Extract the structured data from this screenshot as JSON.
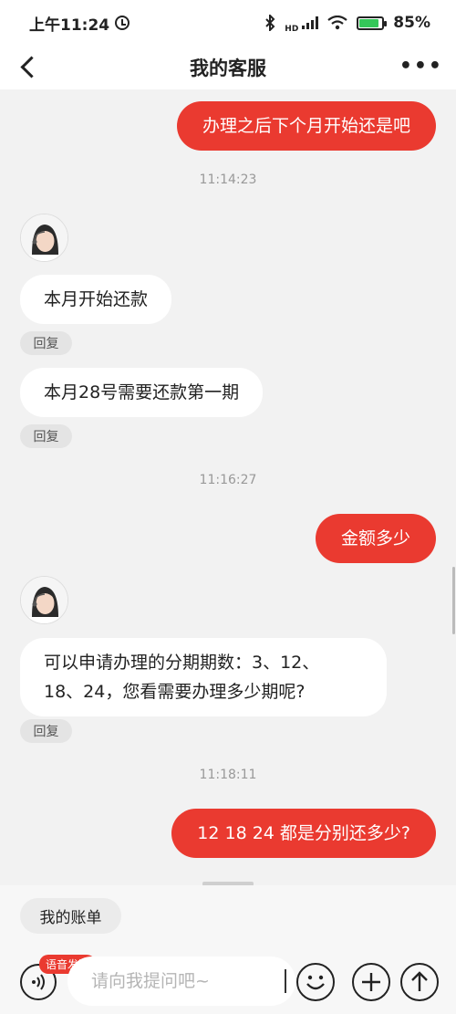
{
  "status_bar": {
    "time": "上午11:24",
    "network_badge": "HD",
    "battery": "85%"
  },
  "header": {
    "title": "我的客服"
  },
  "chat": {
    "messages": [
      {
        "text": "办理之后下个月开始还是吧"
      },
      {
        "text": "11:14:23"
      },
      {
        "text": "本月开始还款"
      },
      {
        "text": "回复"
      },
      {
        "text": "本月28号需要还款第一期"
      },
      {
        "text": "回复"
      },
      {
        "text": "11:16:27"
      },
      {
        "text": "金额多少"
      },
      {
        "line1": "可以申请办理的分期期数：3、12、",
        "line2": "18、24，您看需要办理多少期呢?"
      },
      {
        "text": "回复"
      },
      {
        "text": "11:18:11"
      },
      {
        "text": "12 18 24 都是分别还多少?"
      }
    ]
  },
  "bottom": {
    "quick_reply": "我的账单",
    "voice_badge": "语音发送",
    "input_placeholder": "请向我提问吧~"
  },
  "colors": {
    "accent": "#ea3a30",
    "chat_bg": "#f2f2f2",
    "bubble_left": "#ffffff"
  }
}
